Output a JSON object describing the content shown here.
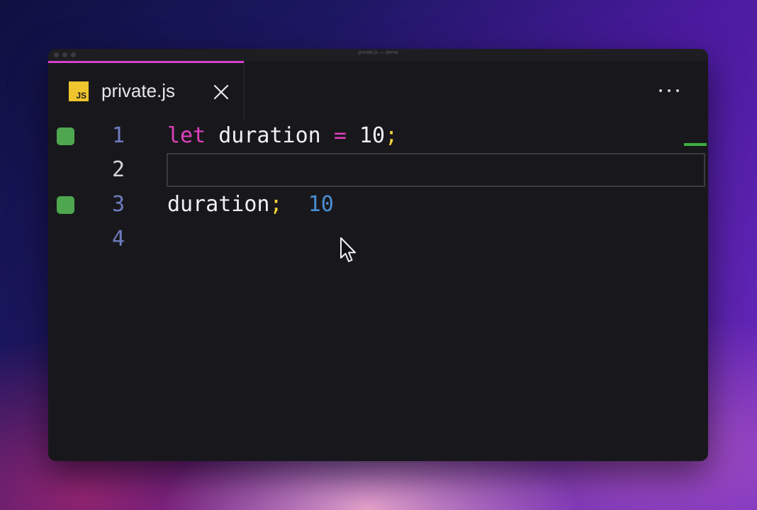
{
  "window": {
    "title": "private.js — demo"
  },
  "tabs": [
    {
      "icon_label": "JS",
      "label": "private.js",
      "icon": "javascript-file-icon",
      "active": true
    }
  ],
  "editor": {
    "lines": [
      {
        "number": "1",
        "has_marker": true,
        "tokens": [
          {
            "type": "keyword",
            "text": "let"
          },
          {
            "type": "space",
            "text": " "
          },
          {
            "type": "ident",
            "text": "duration"
          },
          {
            "type": "space",
            "text": " "
          },
          {
            "type": "op",
            "text": "="
          },
          {
            "type": "space",
            "text": " "
          },
          {
            "type": "num",
            "text": "10"
          },
          {
            "type": "semi",
            "text": ";"
          }
        ]
      },
      {
        "number": "2",
        "has_marker": false,
        "current": true,
        "tokens": []
      },
      {
        "number": "3",
        "has_marker": true,
        "tokens": [
          {
            "type": "ident",
            "text": "duration"
          },
          {
            "type": "semi",
            "text": ";"
          }
        ],
        "inline_result": "10"
      },
      {
        "number": "4",
        "has_marker": false,
        "tokens": []
      }
    ]
  },
  "colors": {
    "tab_accent": "#d83fd0",
    "marker": "#4ea74f",
    "keyword": "#e13fbd",
    "semicolon": "#f5d23a",
    "result": "#4a8ed2",
    "line_number": "#6e7cbf"
  }
}
